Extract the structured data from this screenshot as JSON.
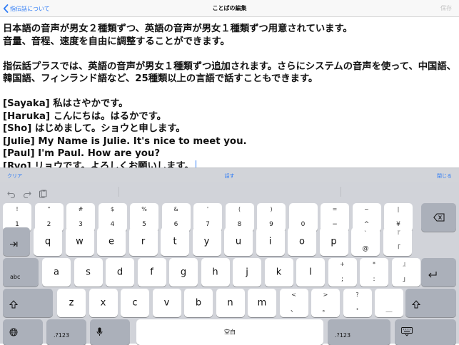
{
  "nav": {
    "back_label": "指伝話について",
    "title": "ことばの編集",
    "right_label": "保存"
  },
  "editor": {
    "lines": [
      "日本語の音声が男女２種類ずつ、英語の音声が男女１種類ずつ用意されています。",
      "音量、音程、速度を自由に調整することができます。",
      "",
      "指伝話プラスでは、英語の音声が男女１種類ずつ追加されます。さらにシステムの音声を使って、中国語、",
      "韓国語、フィンランド語など、25種類以上の言語で話すこともできます。",
      "",
      "[Sayaka] 私はさやかです。",
      "[Haruka] こんにちは。はるかです。",
      "[Sho] はじめまして。ショウと申します。",
      "[Julie] My Name is Julie. It's nice to meet you.",
      "[Paul] I'm Paul. How are you?",
      "[Ryo] リョウです。よろしくお願いします。"
    ]
  },
  "accessory": {
    "clear_label": "クリア",
    "speak_label": "話す",
    "close_label": "閉じる"
  },
  "shortcut_bar": {
    "icons": [
      "undo-icon",
      "redo-icon",
      "paste-icon"
    ]
  },
  "keyboard": {
    "row1": [
      {
        "top": "!",
        "bottom": "1"
      },
      {
        "top": "\"",
        "bottom": "2"
      },
      {
        "top": "#",
        "bottom": "3"
      },
      {
        "top": "$",
        "bottom": "4"
      },
      {
        "top": "%",
        "bottom": "5"
      },
      {
        "top": "&",
        "bottom": "6"
      },
      {
        "top": "'",
        "bottom": "7"
      },
      {
        "top": "(",
        "bottom": "8"
      },
      {
        "top": ")",
        "bottom": "9"
      },
      {
        "top": "",
        "bottom": "0"
      },
      {
        "top": "=",
        "bottom": "−"
      },
      {
        "top": "~",
        "bottom": "^"
      },
      {
        "top": "|",
        "bottom": "¥"
      }
    ],
    "row2": [
      "q",
      "w",
      "e",
      "r",
      "t",
      "y",
      "u",
      "i",
      "o",
      "p"
    ],
    "row2_extra": [
      {
        "top": "`",
        "bottom": "@"
      },
      {
        "top": "『",
        "bottom": "「"
      }
    ],
    "row3": [
      "a",
      "s",
      "d",
      "f",
      "g",
      "h",
      "j",
      "k",
      "l"
    ],
    "row3_extra": [
      {
        "top": "+",
        "bottom": ";"
      },
      {
        "top": "*",
        "bottom": ":"
      },
      {
        "top": "』",
        "bottom": "」"
      }
    ],
    "row4": [
      "z",
      "x",
      "c",
      "v",
      "b",
      "n",
      "m"
    ],
    "row4_extra": [
      {
        "top": "<",
        "bottom": "、"
      },
      {
        "top": ">",
        "bottom": "。"
      },
      {
        "top": "?",
        "bottom": "・"
      },
      {
        "top": "",
        "bottom": "＿"
      }
    ],
    "abc_label": "abc",
    "numbers_label": ".?123",
    "space_label": "空白"
  },
  "colors": {
    "accent": "#2f7cf6",
    "keyboard_bg": "#d1d3d9",
    "dark_key": "#abb0ba"
  }
}
